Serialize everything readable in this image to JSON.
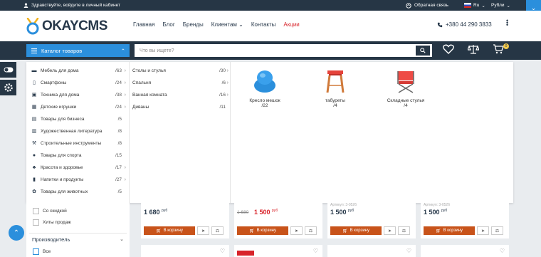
{
  "topbar": {
    "login_text": "Здравствуйте, войдите в личный кабинет",
    "feedback": "Обратная связь",
    "language": "Ru",
    "currency": "Рубли"
  },
  "header": {
    "logo_text": "OKAYCMS",
    "nav": [
      "Главная",
      "Блог",
      "Бренды",
      "Клиентам",
      "Контакты",
      "Акции"
    ],
    "phone": "+380 44 290 3833"
  },
  "searchbar": {
    "catalog_label": "Каталог товаров",
    "search_placeholder": "Что вы ищете?",
    "cart_count": "0"
  },
  "catalog": {
    "categories": [
      {
        "label": "Мебель для дома",
        "count": "/63",
        "icon": "sofa-icon",
        "arrow": true
      },
      {
        "label": "Смартфоны",
        "count": "/24",
        "icon": "smartphone-icon",
        "arrow": true
      },
      {
        "label": "Техника для дома",
        "count": "/38",
        "icon": "appliance-icon",
        "arrow": true
      },
      {
        "label": "Детские игрушки",
        "count": "/24",
        "icon": "toys-icon",
        "arrow": true
      },
      {
        "label": "Товары для бизнеса",
        "count": "/5",
        "icon": "business-icon",
        "arrow": false
      },
      {
        "label": "Художественная литература",
        "count": "/8",
        "icon": "books-icon",
        "arrow": false
      },
      {
        "label": "Строительные инструменты",
        "count": "/8",
        "icon": "tools-icon",
        "arrow": false
      },
      {
        "label": "Товары для спорта",
        "count": "/15",
        "icon": "sport-icon",
        "arrow": false
      },
      {
        "label": "Красота и здоровье",
        "count": "/17",
        "icon": "beauty-icon",
        "arrow": true
      },
      {
        "label": "Напитки и продукты",
        "count": "/27",
        "icon": "drinks-icon",
        "arrow": true
      },
      {
        "label": "Товары для животных",
        "count": "/5",
        "icon": "paw-icon",
        "arrow": false
      }
    ],
    "subcategories": [
      {
        "label": "Столы и стулья",
        "count": "/30",
        "arrow": true
      },
      {
        "label": "Спальня",
        "count": "/6",
        "arrow": true
      },
      {
        "label": "Ванная комната",
        "count": "/16",
        "arrow": true
      },
      {
        "label": "Диваны",
        "count": "/11",
        "arrow": false
      }
    ],
    "featured": [
      {
        "label": "Кресло мешок",
        "count": "/22"
      },
      {
        "label": "табуреты",
        "count": "/4"
      },
      {
        "label": "Складные стулья",
        "count": "/4"
      }
    ]
  },
  "filters": {
    "options": [
      "Со скидкой",
      "Хиты продаж"
    ],
    "section_title": "Производитель",
    "all_label": "Все"
  },
  "products": [
    {
      "price": "1 680",
      "currency": "руб",
      "old_price": "",
      "article": ""
    },
    {
      "price": "1 500",
      "currency": "руб",
      "old_price": "1 680",
      "article": ""
    },
    {
      "price": "1 500",
      "currency": "руб",
      "old_price": "",
      "article": "Артикул: 3-0526"
    },
    {
      "price": "1 500",
      "currency": "руб",
      "old_price": "",
      "article": "Артикул: 3-0526"
    }
  ],
  "buy_label": "В корзину",
  "colors": {
    "accent": "#2b8fdc",
    "dark": "#263645",
    "buy": "#c8531a",
    "sale": "#d8232a"
  }
}
